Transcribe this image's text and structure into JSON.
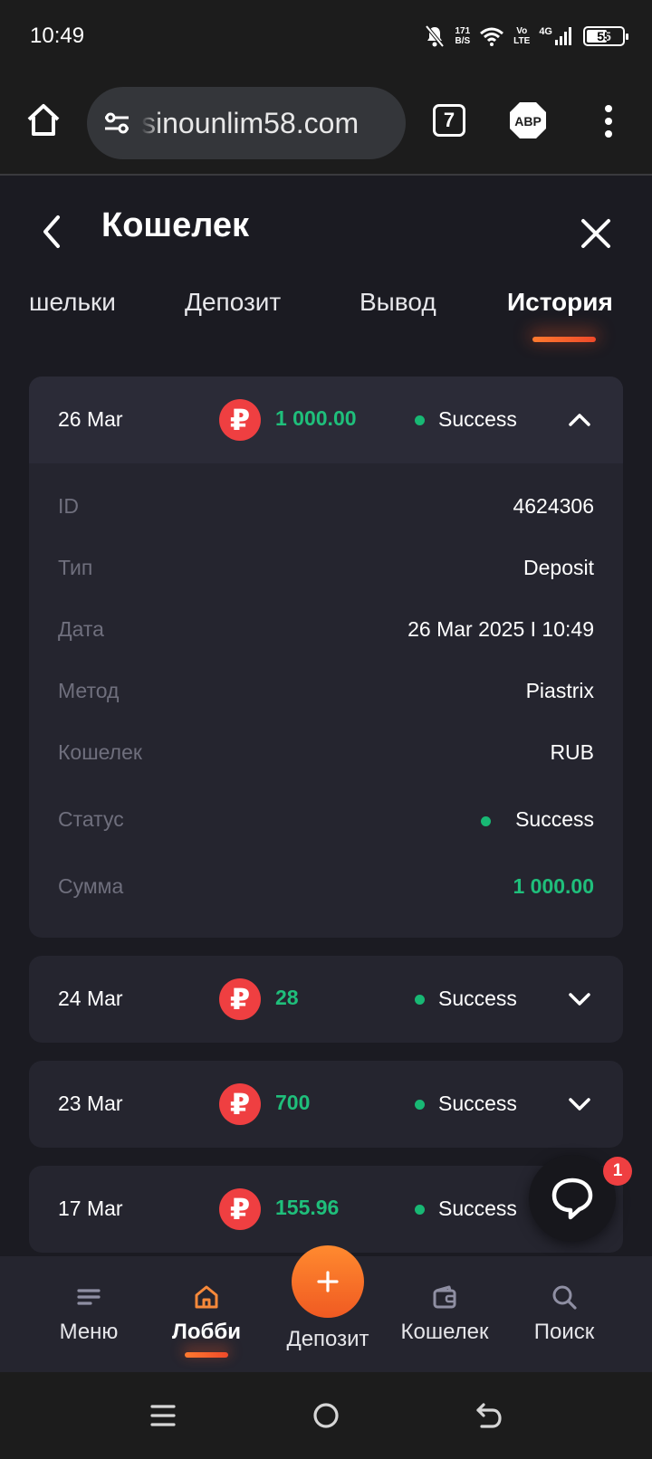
{
  "status_bar": {
    "time": "10:49",
    "net_speed_value": "171",
    "net_speed_unit": "B/S",
    "volte_top": "Vo",
    "volte_bottom": "LTE",
    "network": "4G",
    "battery": "55"
  },
  "browser": {
    "url": "sinounlim58.com",
    "tab_count": "7",
    "adblock_label": "ABP"
  },
  "header": {
    "title": "Кошелек"
  },
  "tabs": [
    {
      "label": "шельки",
      "active": false
    },
    {
      "label": "Депозит",
      "active": false
    },
    {
      "label": "Вывод",
      "active": false
    },
    {
      "label": "История",
      "active": true
    }
  ],
  "currency_symbol": "₽",
  "transactions": [
    {
      "date": "26 Mar",
      "amount": "1 000.00",
      "status": "Success",
      "expanded": true,
      "details": [
        {
          "label": "ID",
          "value": "4624306"
        },
        {
          "label": "Тип",
          "value": "Deposit"
        },
        {
          "label": "Дата",
          "value": "26 Mar 2025 I 10:49"
        },
        {
          "label": "Метод",
          "value": "Piastrix"
        },
        {
          "label": "Кошелек",
          "value": "RUB"
        },
        {
          "label": "Статус",
          "value": "Success"
        },
        {
          "label": "Сумма",
          "value": "1 000.00"
        }
      ]
    },
    {
      "date": "24 Mar",
      "amount": "28",
      "status": "Success",
      "expanded": false
    },
    {
      "date": "23 Mar",
      "amount": "700",
      "status": "Success",
      "expanded": false
    },
    {
      "date": "17 Mar",
      "amount": "155.96",
      "status": "Success",
      "expanded": false
    }
  ],
  "chat": {
    "badge": "1"
  },
  "bottom_nav": [
    {
      "label": "Меню",
      "icon": "menu-icon",
      "active": false
    },
    {
      "label": "Лобби",
      "icon": "home-icon",
      "active": true
    },
    {
      "label": "Депозит",
      "icon": "plus-icon",
      "active": false
    },
    {
      "label": "Кошелек",
      "icon": "wallet-icon",
      "active": false
    },
    {
      "label": "Поиск",
      "icon": "search-icon",
      "active": false
    }
  ],
  "colors": {
    "accent": "#f26b2a",
    "success": "#1fbf7b",
    "currency_badge": "#ef3f41",
    "background": "#1b1b22",
    "card": "#25252f"
  }
}
